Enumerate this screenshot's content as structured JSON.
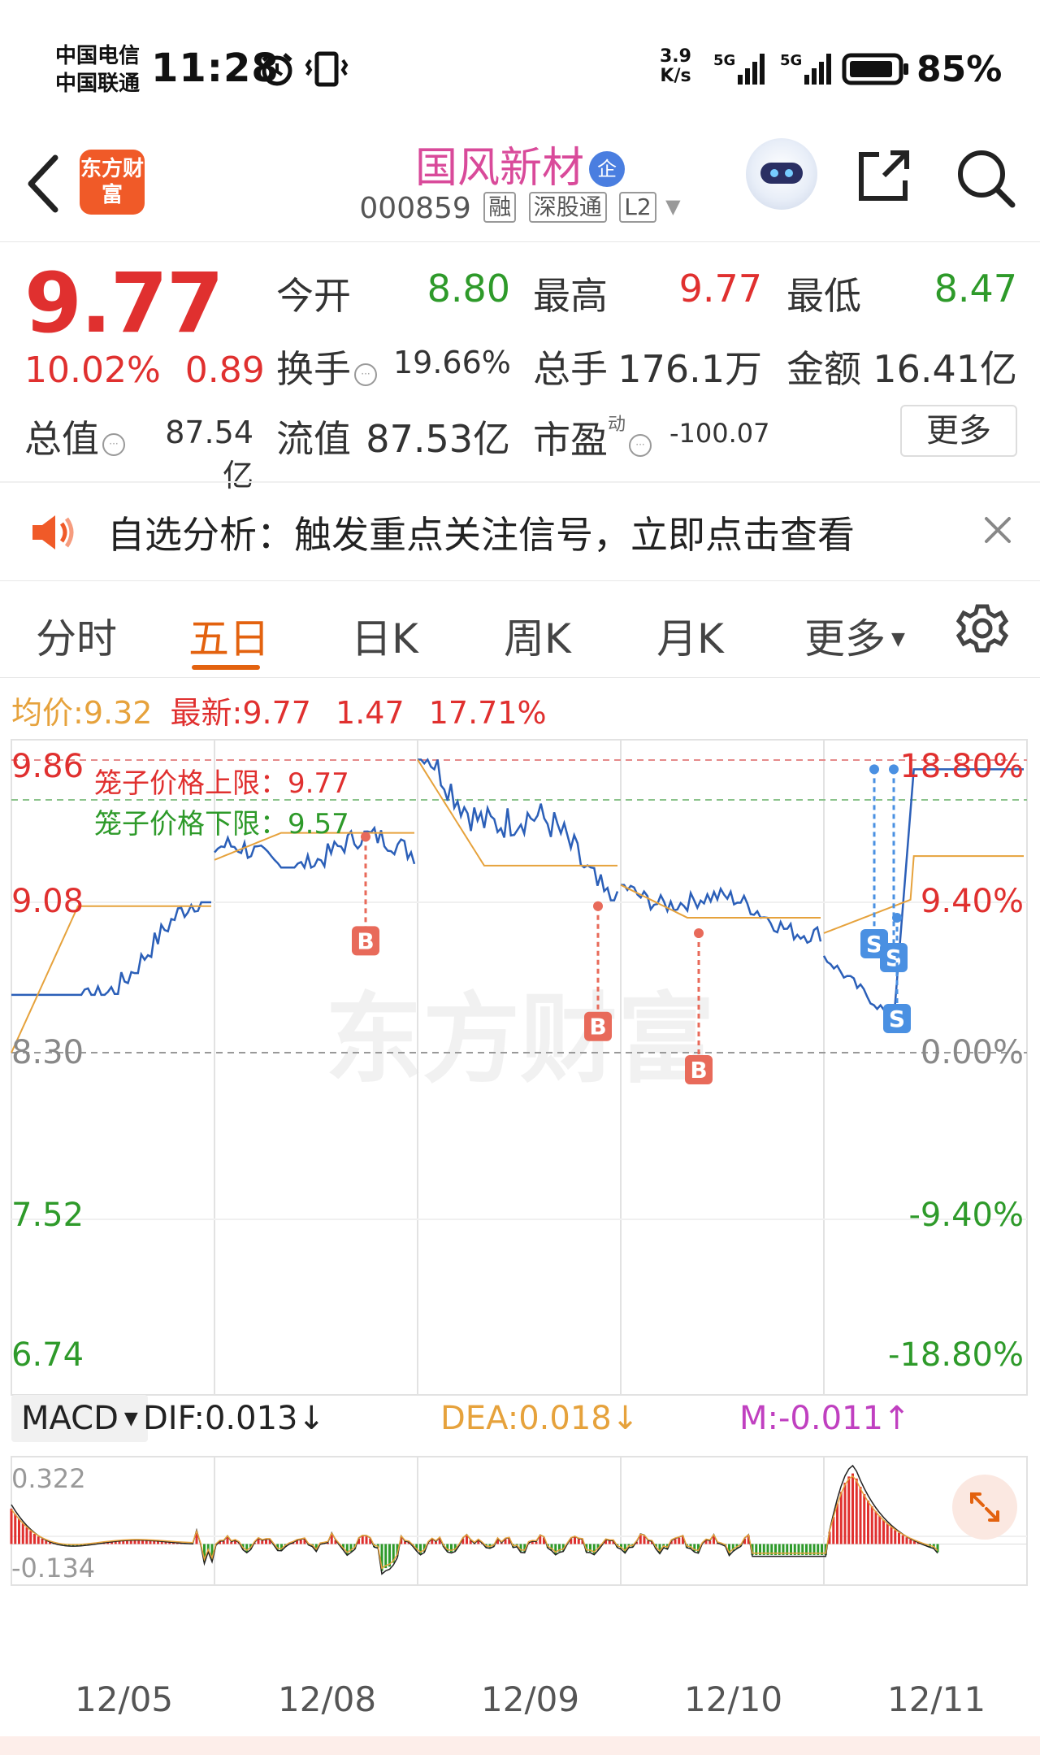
{
  "status_bar": {
    "carrier1": "中国电信",
    "carrier2": "中国联通",
    "time": "11:28",
    "net_speed_value": "3.9",
    "net_speed_unit": "K/s",
    "battery": "85%",
    "icons": [
      "alarm-icon",
      "vibrate-icon",
      "signal-5g-icon",
      "signal-5g-icon",
      "battery-icon"
    ]
  },
  "header": {
    "app_logo_text": "东方财富",
    "stock_name": "国风新材",
    "qi_badge": "企",
    "code": "000859",
    "tags": [
      "融",
      "深股通",
      "L2"
    ]
  },
  "quote": {
    "price": "9.77",
    "change_pct": "10.02%",
    "change_amt": "0.89",
    "open_label": "今开",
    "open": "8.80",
    "high_label": "最高",
    "high": "9.77",
    "low_label": "最低",
    "low": "8.47",
    "turnover_label": "换手",
    "turnover": "19.66%",
    "volume_label": "总手",
    "volume": "176.1万",
    "amount_label": "金额",
    "amount": "16.41亿",
    "mcap_label": "总值",
    "mcap": "87.54亿",
    "float_label": "流值",
    "float": "87.53亿",
    "pe_label": "市盈",
    "pe_sup": "动",
    "pe": "-100.07",
    "more": "更多"
  },
  "notice": {
    "text": "自选分析：触发重点关注信号，立即点击查看"
  },
  "tabs": [
    "分时",
    "五日",
    "日K",
    "周K",
    "月K",
    "更多"
  ],
  "active_tab": "五日",
  "legend": {
    "avg_label": "均价:",
    "avg": "9.32",
    "latest_label": "最新:",
    "latest": "9.77",
    "chg": "1.47",
    "pct": "17.71%"
  },
  "chart_labels": {
    "cage_upper": "笼子价格上限：9.77",
    "cage_lower": "笼子价格下限：9.57",
    "left_axis": [
      "9.86",
      "9.08",
      "8.30",
      "7.52",
      "6.74"
    ],
    "right_axis": [
      "18.80%",
      "9.40%",
      "0.00%",
      "-9.40%",
      "-18.80%"
    ],
    "markers": [
      "B",
      "B",
      "B",
      "S",
      "S",
      "S"
    ],
    "watermark": "东方财富"
  },
  "macd": {
    "selector": "MACD",
    "dif": "DIF:0.013↓",
    "dea": "DEA:0.018↓",
    "m": "M:-0.011↑",
    "ymax": "0.322",
    "ymin": "-0.134"
  },
  "dates": [
    "12/05",
    "12/08",
    "12/09",
    "12/10",
    "12/11"
  ],
  "colors": {
    "up": "#e0302f",
    "down": "#2e9a2a",
    "accent": "#e3620f",
    "price_line": "#2b5fb8",
    "avg_line": "#e6a23c",
    "macd_m": "#c040c0"
  },
  "chart_data": {
    "type": "line",
    "title": "",
    "x": [
      "12/05",
      "12/08",
      "12/09",
      "12/10",
      "12/11"
    ],
    "ylim": [
      6.74,
      9.86
    ],
    "prev_close": 8.3,
    "series": [
      {
        "name": "最新",
        "values": [
          9.08,
          9.37,
          9.16,
          8.95,
          9.77
        ],
        "day_low": [
          8.6,
          9.26,
          9.09,
          8.8,
          8.47
        ],
        "day_high": [
          9.08,
          9.73,
          9.82,
          9.17,
          9.77
        ]
      },
      {
        "name": "均价",
        "values": [
          9.06,
          9.44,
          9.27,
          9.0,
          9.32
        ]
      }
    ],
    "signals": [
      {
        "type": "B",
        "day": "12/08",
        "price": 9.42
      },
      {
        "type": "B",
        "day": "12/09",
        "price": 9.06
      },
      {
        "type": "B",
        "day": "12/10",
        "price": 8.92
      },
      {
        "type": "S",
        "day": "12/11",
        "price": 9.77
      },
      {
        "type": "S",
        "day": "12/11",
        "price": 9.77
      },
      {
        "type": "S",
        "day": "12/11",
        "price": 9.0
      }
    ],
    "macd": {
      "ylim": [
        -0.134,
        0.322
      ],
      "dif": 0.013,
      "dea": 0.018,
      "m": -0.011
    }
  }
}
